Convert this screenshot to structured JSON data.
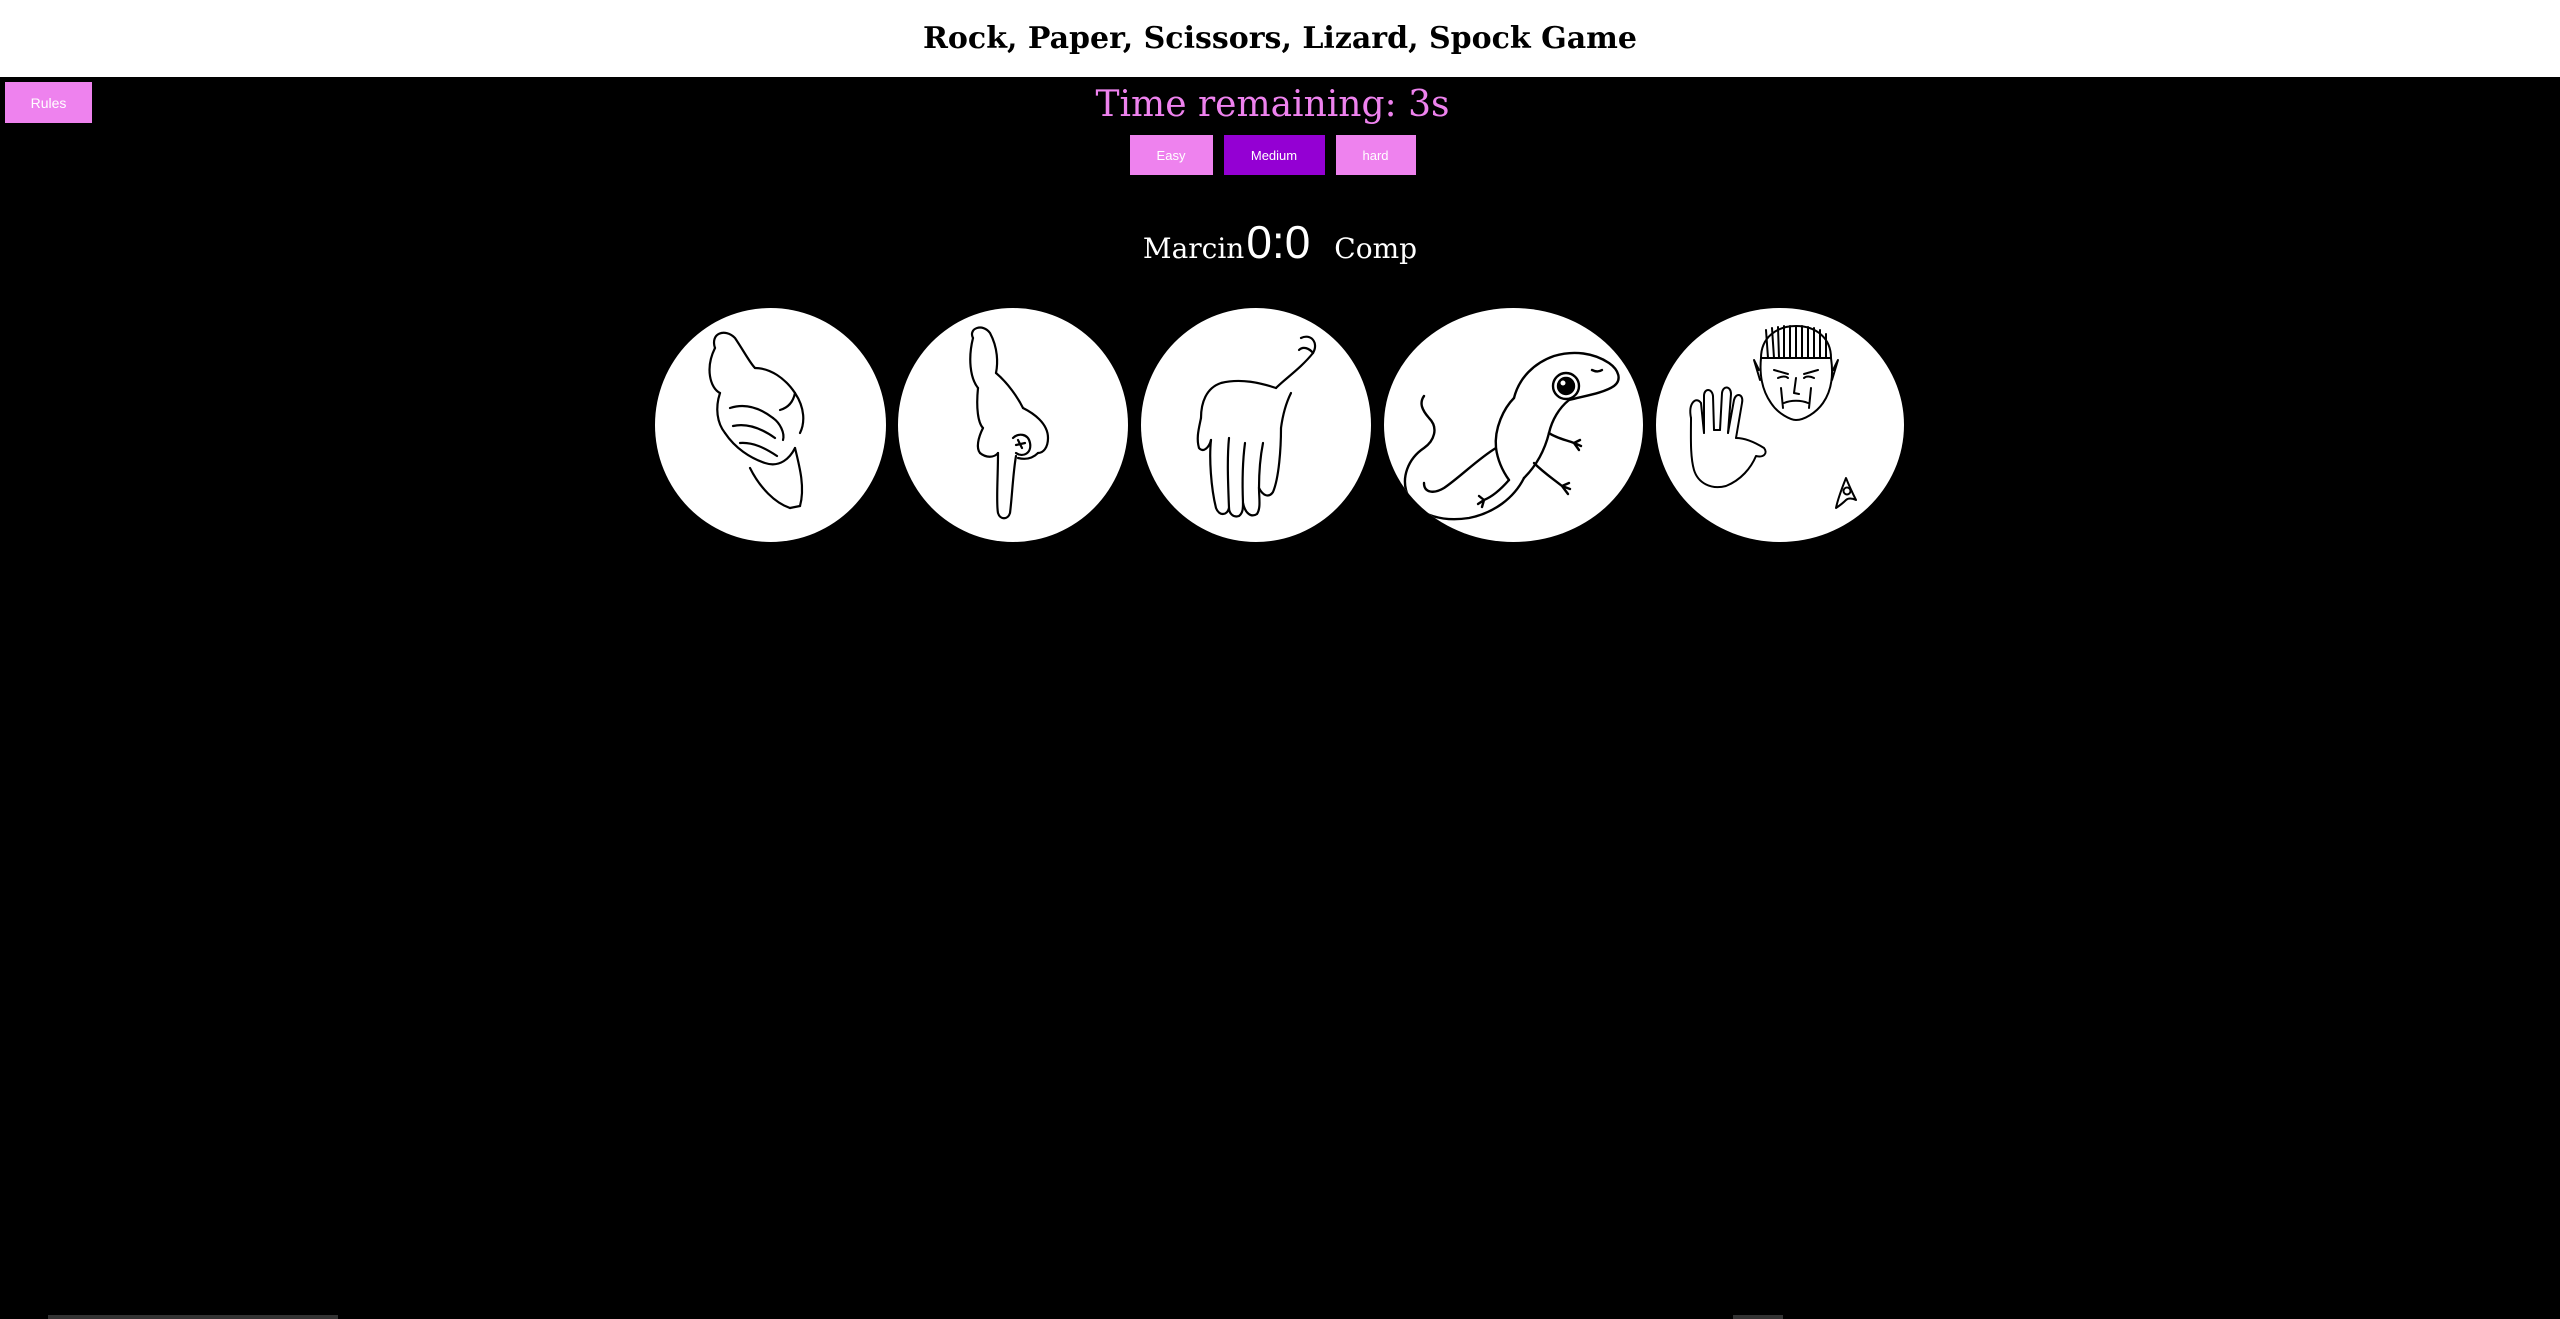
{
  "header": {
    "title": "Rock, Paper, Scissors, Lizard, Spock Game"
  },
  "rules": {
    "label": "Rules"
  },
  "timer": {
    "text": "Time remaining: 3s"
  },
  "difficulty": {
    "easy": "Easy",
    "medium": "Medium",
    "hard": "hard",
    "selected": "Medium"
  },
  "score": {
    "player": "Marcin",
    "value": "0:0",
    "opponent": "Comp"
  },
  "choices": [
    {
      "icon": "rock-hand-icon"
    },
    {
      "icon": "paper-hand-icon"
    },
    {
      "icon": "scissors-hand-icon"
    },
    {
      "icon": "lizard-icon"
    },
    {
      "icon": "spock-icon"
    }
  ],
  "colors": {
    "accent": "#ee82ee",
    "active": "#9400d3",
    "background": "#000000"
  }
}
